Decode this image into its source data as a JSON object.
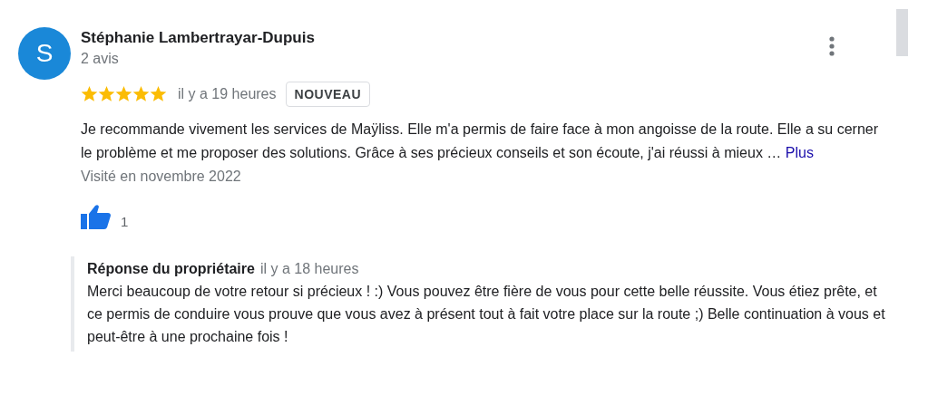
{
  "review": {
    "avatar_letter": "S",
    "author": "Stéphanie Lambertrayar-Dupuis",
    "review_count": "2 avis",
    "stars": 5,
    "time": "il y a 19 heures",
    "badge": "NOUVEAU",
    "text": "Je recommande vivement les services de Maÿliss. Elle m'a permis de faire face à mon angoisse de la route. Elle a su cerner le problème et me proposer des solutions. Grâce à ses précieux conseils et son écoute, j'ai réussi à mieux …",
    "more_link": "Plus",
    "visited": "Visité en novembre 2022",
    "likes": "1"
  },
  "owner_response": {
    "title": "Réponse du propriétaire",
    "time": "il y a 18 heures",
    "text": "Merci beaucoup de votre retour si précieux ! :) Vous pouvez être fière de vous pour cette belle réussite. Vous étiez prête, et ce permis de conduire vous prouve que vous avez à présent tout à fait votre place sur la route ;) Belle continuation à vous et peut-être à une prochaine fois !"
  }
}
